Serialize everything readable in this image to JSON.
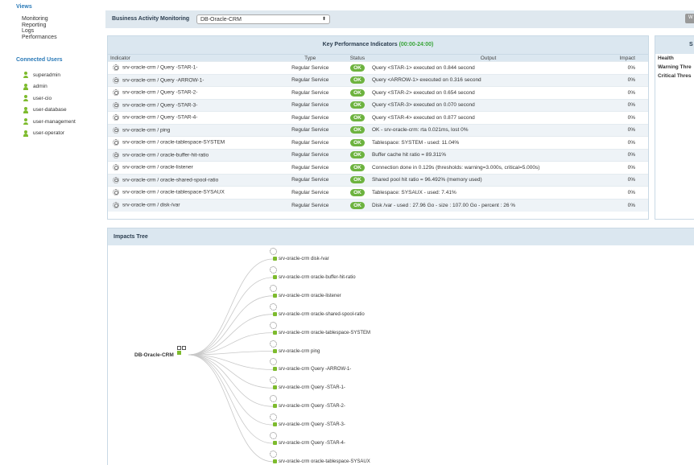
{
  "sidebar": {
    "views_heading": "Views",
    "views": [
      "Monitoring",
      "Reporting",
      "Logs",
      "Performances"
    ],
    "users_heading": "Connected Users",
    "users": [
      "superadmin",
      "admin",
      "user-cio",
      "user-database",
      "user-management",
      "user-operator"
    ]
  },
  "topbar": {
    "bam_label": "Business Activity Monitoring",
    "bam_selected": "DB-Oracle-CRM",
    "bam_select_arrow": "⬍",
    "button_label": "W"
  },
  "kpi": {
    "title": "Key Performance Indicators",
    "time_range": "(00:00-24:00)",
    "columns": [
      "Indicator",
      "Type",
      "Status",
      "Output",
      "Impact"
    ],
    "rows": [
      {
        "indicator": "srv-oracle-crm / Query -STAR-1-",
        "type": "Regular Service",
        "status": "OK",
        "output": "Query <STAR-1> executed on 0.844 second",
        "impact": "0%"
      },
      {
        "indicator": "srv-oracle-crm / Query -ARROW-1-",
        "type": "Regular Service",
        "status": "OK",
        "output": "Query <ARROW-1> executed on 0.316 second",
        "impact": "0%"
      },
      {
        "indicator": "srv-oracle-crm / Query -STAR-2-",
        "type": "Regular Service",
        "status": "OK",
        "output": "Query <STAR-2> executed on 0.654 second",
        "impact": "0%"
      },
      {
        "indicator": "srv-oracle-crm / Query -STAR-3-",
        "type": "Regular Service",
        "status": "OK",
        "output": "Query <STAR-3> executed on 0.070 second",
        "impact": "0%"
      },
      {
        "indicator": "srv-oracle-crm / Query -STAR-4-",
        "type": "Regular Service",
        "status": "OK",
        "output": "Query <STAR-4> executed on 0.877 second",
        "impact": "0%"
      },
      {
        "indicator": "srv-oracle-crm / ping",
        "type": "Regular Service",
        "status": "OK",
        "output": "OK - srv-oracle-crm: rta 0.021ms, lost 0%",
        "impact": "0%"
      },
      {
        "indicator": "srv-oracle-crm / oracle-tablespace-SYSTEM",
        "type": "Regular Service",
        "status": "OK",
        "output": "Tablespace: SYSTEM - used: 11.04%",
        "impact": "0%"
      },
      {
        "indicator": "srv-oracle-crm / oracle-buffer-hit-ratio",
        "type": "Regular Service",
        "status": "OK",
        "output": "Buffer cache hit ratio = 89.311%",
        "impact": "0%"
      },
      {
        "indicator": "srv-oracle-crm / oracle-listener",
        "type": "Regular Service",
        "status": "OK",
        "output": "Connection done in 0.129s (thresholds: warning=3.000s, critical=5.000s)",
        "impact": "0%"
      },
      {
        "indicator": "srv-oracle-crm / oracle-shared-spool-ratio",
        "type": "Regular Service",
        "status": "OK",
        "output": "Shared pool hit ratio = 96.492% (memory used)",
        "impact": "0%"
      },
      {
        "indicator": "srv-oracle-crm / oracle-tablespace-SYSAUX",
        "type": "Regular Service",
        "status": "OK",
        "output": "Tablespace: SYSAUX - used: 7.41%",
        "impact": "0%"
      },
      {
        "indicator": "srv-oracle-crm / disk-/var",
        "type": "Regular Service",
        "status": "OK",
        "output": "Disk /var - used : 27.96 Go - size : 107.00 Go - percent : 26 %",
        "impact": "0%"
      }
    ]
  },
  "side_panel": {
    "heading": "S",
    "rows": [
      "Health",
      "Warning Thre",
      "Critical Thres"
    ]
  },
  "tree": {
    "title": "Impacts Tree",
    "root": "DB-Oracle-CRM",
    "leaves": [
      "srv-oracle-crm disk-/var",
      "srv-oracle-crm oracle-buffer-hit-ratio",
      "srv-oracle-crm oracle-listener",
      "srv-oracle-crm oracle-shared-spool-ratio",
      "srv-oracle-crm oracle-tablespace-SYSTEM",
      "srv-oracle-crm ping",
      "srv-oracle-crm Query -ARROW-1-",
      "srv-oracle-crm Query -STAR-1-",
      "srv-oracle-crm Query -STAR-2-",
      "srv-oracle-crm Query -STAR-3-",
      "srv-oracle-crm Query -STAR-4-",
      "srv-oracle-crm oracle-tablespace-SYSAUX"
    ]
  },
  "colors": {
    "accent": "#2a7ab8",
    "ok": "#6db33f",
    "header_bg": "#dbe7f0"
  }
}
